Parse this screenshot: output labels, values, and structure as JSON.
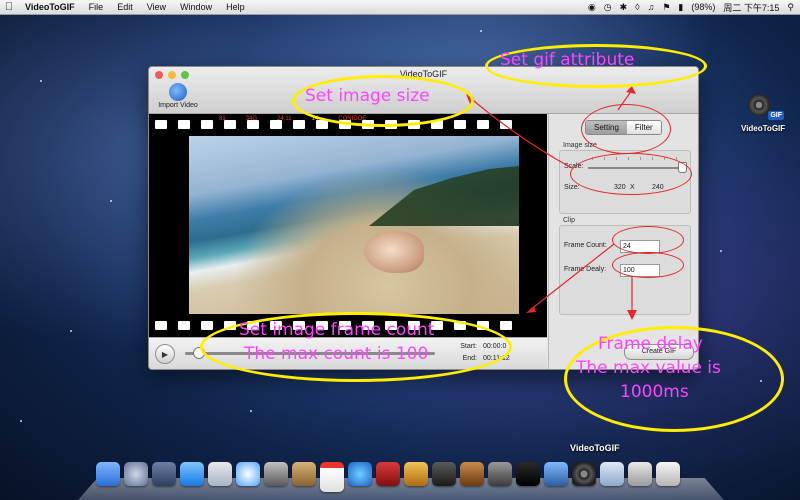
{
  "menubar": {
    "app_name": "VideoToGIF",
    "items": [
      "File",
      "Edit",
      "View",
      "Window",
      "Help"
    ],
    "battery": "(98%)",
    "clock": "周二 下午7:15"
  },
  "window": {
    "title": "VideoToGIF",
    "toolbar": {
      "import_label": "Import Video"
    },
    "film_codes": [
      "81",
      "34G",
      "24 11",
      "14",
      "CONIDOE"
    ],
    "playback": {
      "start_label": "Start:",
      "start_value": "00:00:0",
      "end_label": "End:",
      "end_value": "00:11:12"
    },
    "panel": {
      "tabs": [
        "Setting",
        "Filter"
      ],
      "selected_tab": "Setting",
      "image_size": {
        "title": "Image size",
        "scale_label": "Scale:",
        "size_label": "Size:",
        "width": "320",
        "x_sep": "X",
        "height": "240"
      },
      "clip": {
        "title": "Clip",
        "frame_count_label": "Frame Count:",
        "frame_count_value": "24",
        "frame_delay_label": "Frame Dealy:",
        "frame_delay_value": "100"
      },
      "create_button": "Create GIF"
    }
  },
  "desktop_icon": {
    "label": "VideoToGIF"
  },
  "dock": {
    "hover_label": "VideoToGIF"
  },
  "annotations": {
    "image_size": "Set image size",
    "gif_attribute": "Set gif attribute",
    "frame_count_line1": "Set image frame count",
    "frame_count_line2": "The max count is 100",
    "frame_delay_line1": "Frame delay",
    "frame_delay_line2": "The max value is",
    "frame_delay_line3": "1000ms"
  },
  "colors": {
    "annotation_text": "#ff44ff",
    "annotation_ellipse": "#ffee00",
    "annotation_arrow": "#e3282c"
  }
}
